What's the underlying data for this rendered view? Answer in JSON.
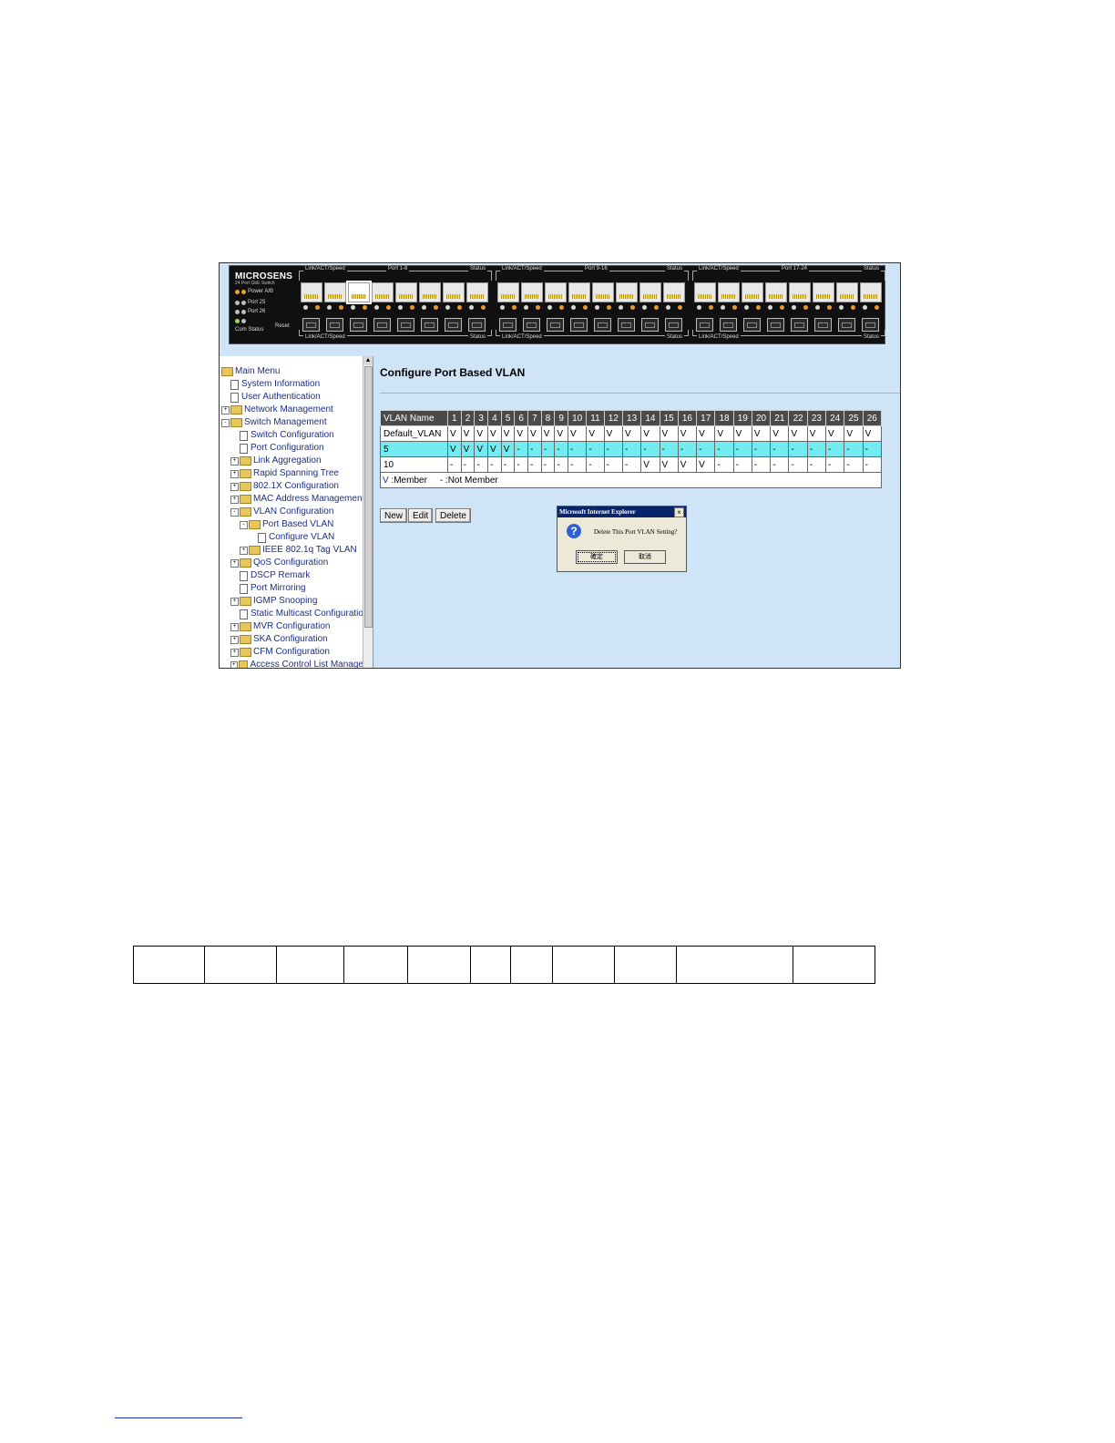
{
  "device": {
    "brand": "MICROSENS",
    "model": "24 Port GbE Switch",
    "leds": {
      "power": "Power A/B",
      "port25": "Port 25",
      "port26": "Port 26",
      "com_status": "Com  Status",
      "reset": "Reset"
    },
    "groups": [
      {
        "link_label": "Link/ACT/Speed",
        "ports_label": "Port 1-8",
        "status_label": "Status",
        "bottom_link": "Link/ACT/Speed",
        "bottom_status": "Status"
      },
      {
        "link_label": "Link/ACT/Speed",
        "ports_label": "Port 9-16",
        "status_label": "Status",
        "bottom_link": "Link/ACT/Speed",
        "bottom_status": "Status"
      },
      {
        "link_label": "Link/ACT/Speed",
        "ports_label": "Port 17-24",
        "status_label": "Status",
        "bottom_link": "Link/ACT/Speed",
        "bottom_status": "Status"
      }
    ]
  },
  "menu": [
    {
      "label": "Main Menu",
      "kind": "folder",
      "level": 0,
      "expander": ""
    },
    {
      "label": "System Information",
      "kind": "doc",
      "level": 1,
      "expander": ""
    },
    {
      "label": "User Authentication",
      "kind": "doc",
      "level": 1,
      "expander": ""
    },
    {
      "label": "Network Management",
      "kind": "folder",
      "level": 0,
      "expander": "+"
    },
    {
      "label": "Switch Management",
      "kind": "folder",
      "level": 0,
      "expander": "-"
    },
    {
      "label": "Switch Configuration",
      "kind": "doc",
      "level": 2,
      "expander": ""
    },
    {
      "label": "Port Configuration",
      "kind": "doc",
      "level": 2,
      "expander": ""
    },
    {
      "label": "Link Aggregation",
      "kind": "folder",
      "level": 1,
      "expander": "+"
    },
    {
      "label": "Rapid Spanning Tree",
      "kind": "folder",
      "level": 1,
      "expander": "+"
    },
    {
      "label": "802.1X Configuration",
      "kind": "folder",
      "level": 1,
      "expander": "+"
    },
    {
      "label": "MAC Address Managemen",
      "kind": "folder",
      "level": 1,
      "expander": "+"
    },
    {
      "label": "VLAN Configuration",
      "kind": "folder",
      "level": 1,
      "expander": "-"
    },
    {
      "label": "Port Based VLAN",
      "kind": "folder",
      "level": 2,
      "expander": "-"
    },
    {
      "label": "Configure VLAN",
      "kind": "doc",
      "level": 4,
      "expander": ""
    },
    {
      "label": "IEEE 802.1q Tag VLAN",
      "kind": "folder",
      "level": 2,
      "expander": "+"
    },
    {
      "label": "QoS Configuration",
      "kind": "folder",
      "level": 1,
      "expander": "+"
    },
    {
      "label": "DSCP Remark",
      "kind": "doc",
      "level": 2,
      "expander": ""
    },
    {
      "label": "Port Mirroring",
      "kind": "doc",
      "level": 2,
      "expander": ""
    },
    {
      "label": "IGMP Snooping",
      "kind": "folder",
      "level": 1,
      "expander": "+"
    },
    {
      "label": "Static Multicast Configuratio",
      "kind": "doc",
      "level": 2,
      "expander": ""
    },
    {
      "label": "MVR Configuration",
      "kind": "folder",
      "level": 1,
      "expander": "+"
    },
    {
      "label": "SKA Configuration",
      "kind": "folder",
      "level": 1,
      "expander": "+"
    },
    {
      "label": "CFM Configuration",
      "kind": "folder",
      "level": 1,
      "expander": "+"
    },
    {
      "label": "Access Control List Manage",
      "kind": "folder",
      "level": 1,
      "expander": "+"
    }
  ],
  "content": {
    "title": "Configure Port Based VLAN",
    "table": {
      "name_header": "VLAN Name",
      "ports": [
        "1",
        "2",
        "3",
        "4",
        "5",
        "6",
        "7",
        "8",
        "9",
        "10",
        "11",
        "12",
        "13",
        "14",
        "15",
        "16",
        "17",
        "18",
        "19",
        "20",
        "21",
        "22",
        "23",
        "24",
        "25",
        "26"
      ],
      "rows": [
        {
          "name": "Default_VLAN",
          "selected": false,
          "cells": [
            "V",
            "V",
            "V",
            "V",
            "V",
            "V",
            "V",
            "V",
            "V",
            "V",
            "V",
            "V",
            "V",
            "V",
            "V",
            "V",
            "V",
            "V",
            "V",
            "V",
            "V",
            "V",
            "V",
            "V",
            "V",
            "V"
          ]
        },
        {
          "name": "5",
          "selected": true,
          "cells": [
            "V",
            "V",
            "V",
            "V",
            "V",
            "-",
            "-",
            "-",
            "-",
            "-",
            "-",
            "-",
            "-",
            "-",
            "-",
            "-",
            "-",
            "-",
            "-",
            "-",
            "-",
            "-",
            "-",
            "-",
            "-",
            "-"
          ]
        },
        {
          "name": "10",
          "selected": false,
          "cells": [
            "-",
            "-",
            "-",
            "-",
            "-",
            "-",
            "-",
            "-",
            "-",
            "-",
            "-",
            "-",
            "-",
            "V",
            "V",
            "V",
            "V",
            "-",
            "-",
            "-",
            "-",
            "-",
            "-",
            "-",
            "-",
            "-"
          ]
        }
      ],
      "legend_member_symbol": "V",
      "legend_member": " :Member",
      "legend_not_symbol": "-",
      "legend_not": " :Not Member"
    },
    "buttons": {
      "new": "New",
      "edit": "Edit",
      "delete": "Delete"
    }
  },
  "dialog": {
    "title": "Microsoft Internet Explorer",
    "close": "×",
    "icon": "?",
    "message": "Delete This Port VLAN Setting?",
    "ok": "確定",
    "cancel": "取消"
  }
}
